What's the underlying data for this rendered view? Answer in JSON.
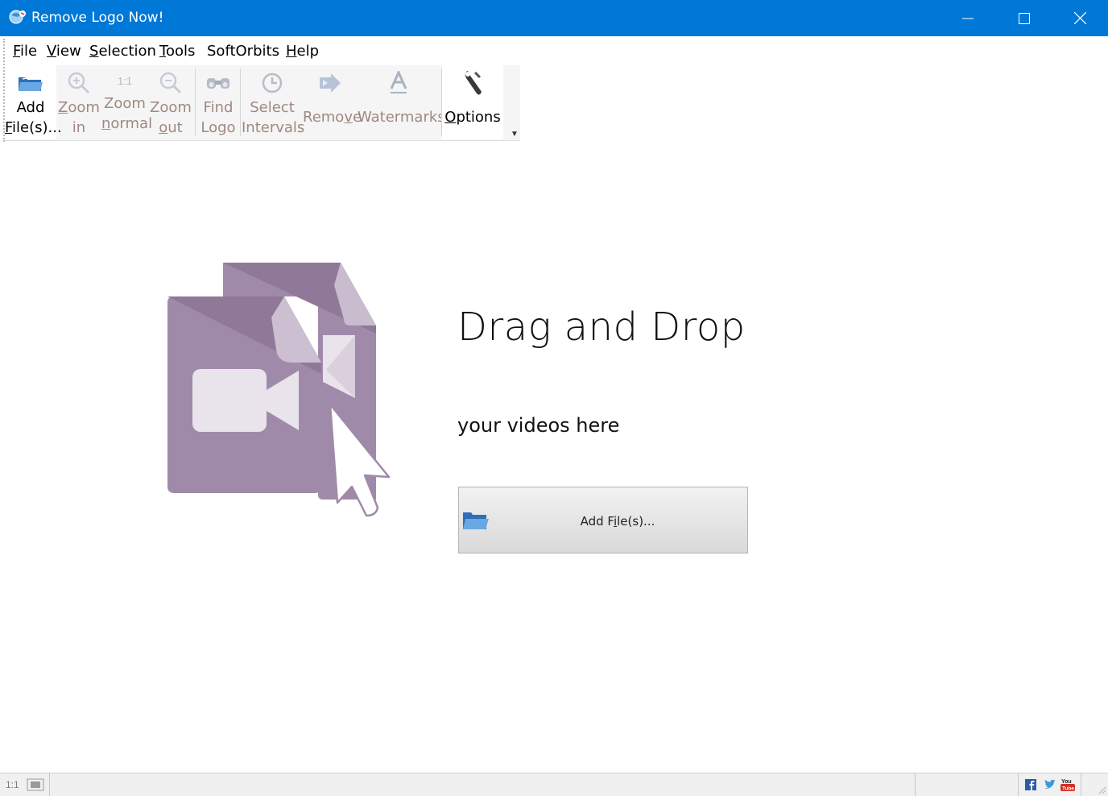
{
  "window": {
    "title": "Remove Logo Now!"
  },
  "menu": {
    "items": [
      {
        "label": "File",
        "mnemonic_index": 0
      },
      {
        "label": "View",
        "mnemonic_index": 0
      },
      {
        "label": "Selection",
        "mnemonic_index": 0
      },
      {
        "label": "Tools",
        "mnemonic_index": 0
      },
      {
        "label": "SoftOrbits",
        "mnemonic_index": -1
      },
      {
        "label": "Help",
        "mnemonic_index": 0
      }
    ]
  },
  "toolbar": {
    "add_files": {
      "line1": "Add",
      "line2": "File(s)...",
      "enabled": true,
      "icon": "open-folder-icon"
    },
    "zoom_in": {
      "line1": "Zoom",
      "line2": "in",
      "enabled": false,
      "icon": "zoom-in-icon"
    },
    "zoom_normal": {
      "line1": "Zoom",
      "line2": "normal",
      "icon_text": "1:1",
      "enabled": false,
      "icon": "zoom-normal-icon"
    },
    "zoom_out": {
      "line1": "Zoom",
      "line2": "out",
      "enabled": false,
      "icon": "zoom-out-icon"
    },
    "find_logo": {
      "line1": "Find",
      "line2": "Logo",
      "enabled": false,
      "icon": "binoculars-icon"
    },
    "select_intervals": {
      "line1": "Select",
      "line2": "Intervals",
      "enabled": false,
      "icon": "clock-icon"
    },
    "remove": {
      "label": "Remove",
      "enabled": false,
      "icon": "arrow-right-icon"
    },
    "watermarks": {
      "label": "Watermarks",
      "enabled": false,
      "icon": "text-a-icon"
    },
    "options": {
      "label": "Options",
      "enabled": true,
      "icon": "wrench-icon"
    }
  },
  "dropzone": {
    "title": "Drag and Drop",
    "subtitle": "your videos here",
    "button_pre": "Add F",
    "button_ul": "i",
    "button_post": "le(s)..."
  },
  "statusbar": {
    "zoom_label": "1:1"
  },
  "colors": {
    "titlebar": "#0078d7",
    "illustration": "#a08aaa",
    "disabled_text": "#a08880"
  }
}
